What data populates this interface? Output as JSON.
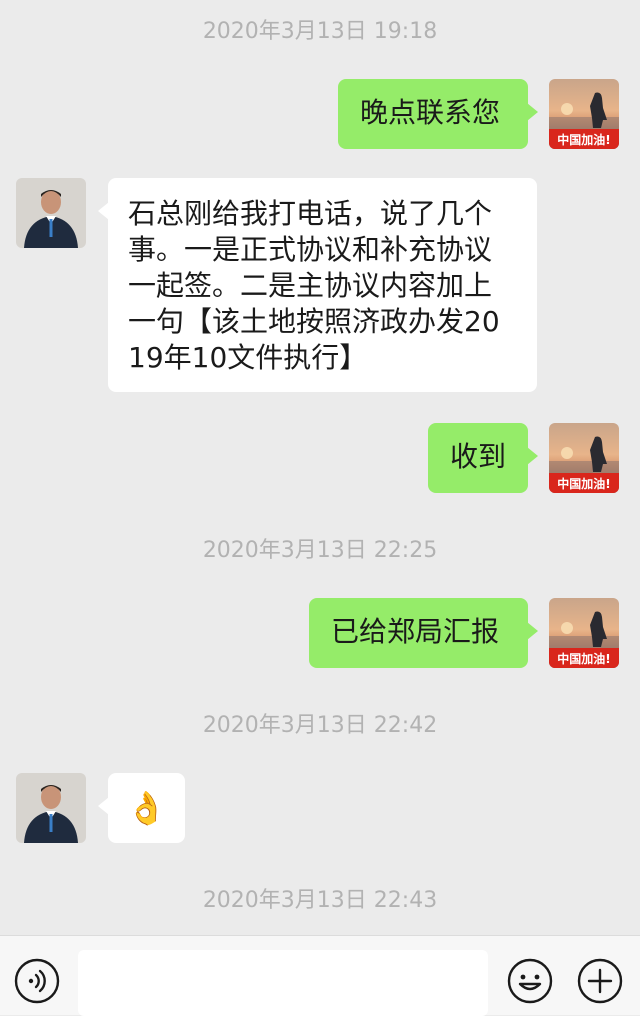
{
  "messages": [
    {
      "type": "timestamp",
      "text": "2020年3月13日 19:18"
    },
    {
      "type": "out",
      "text": "晚点联系您",
      "avatar_badge": "中国加油!"
    },
    {
      "type": "in",
      "text": "石总刚给我打电话，说了几个事。一是正式协议和补充协议一起签。二是主协议内容加上一句【该土地按照济政办发2019年10文件执行】"
    },
    {
      "type": "out",
      "text": "收到",
      "avatar_badge": "中国加油!"
    },
    {
      "type": "timestamp",
      "text": "2020年3月13日 22:25"
    },
    {
      "type": "out",
      "text": "已给郑局汇报",
      "avatar_badge": "中国加油!"
    },
    {
      "type": "timestamp",
      "text": "2020年3月13日 22:42"
    },
    {
      "type": "in",
      "emoji": "👌",
      "emoji_name": "ok-hand-emoji"
    },
    {
      "type": "timestamp",
      "text": "2020年3月13日 22:43"
    }
  ],
  "composer": {
    "input_value": "",
    "voice_icon": "voice-icon",
    "emoji_icon": "emoji-smiley-icon",
    "plus_icon": "plus-icon"
  },
  "colors": {
    "background": "#ebebeb",
    "out_bubble": "#95ec69",
    "in_bubble": "#ffffff",
    "timestamp": "#b2b2b2",
    "badge_red": "#d9261c"
  }
}
